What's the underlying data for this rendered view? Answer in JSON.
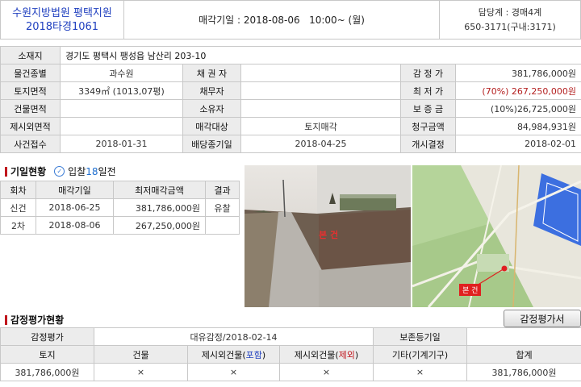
{
  "header": {
    "court": "수원지방법원 평택지원",
    "case_no": "2018타경1061",
    "sale_date": "매각기일 : 2018-08-06   10:00~ (월)",
    "dept": "담당계 : 경매4계",
    "phone": "650-3171(구내:3171)"
  },
  "info": {
    "address_label": "소재지",
    "address": "경기도 평택시 팽성읍 남산리 203-10",
    "rows": [
      [
        "물건종별",
        "과수원",
        "채 권 자",
        "",
        "감 정 가",
        "381,786,000원"
      ],
      [
        "토지면적",
        "3349㎡ (1013,07평)",
        "채무자",
        "",
        "최 저 가",
        "(70%) 267,250,000원"
      ],
      [
        "건물면적",
        "",
        "소유자",
        "",
        "보 증 금",
        "(10%)26,725,000원"
      ],
      [
        "제시외면적",
        "",
        "매각대상",
        "토지매각",
        "청구금액",
        "84,984,931원"
      ],
      [
        "사건접수",
        "2018-01-31",
        "배당종기일",
        "2018-04-25",
        "개시결정",
        "2018-02-01"
      ]
    ]
  },
  "history": {
    "title": "기일현황",
    "badge_prefix": "입찰",
    "badge_days": "18",
    "badge_suffix": "일전",
    "headers": [
      "회차",
      "매각기일",
      "최저매각금액",
      "결과"
    ],
    "rows": [
      [
        "신건",
        "2018-06-25",
        "381,786,000원",
        "유찰"
      ],
      [
        "2차",
        "2018-08-06",
        "267,250,000원",
        ""
      ]
    ]
  },
  "photo_label": "본 건",
  "map_label": "본 건",
  "appraisal": {
    "title": "감정평가현황",
    "button": "감정평가서",
    "row1": [
      "감정평가",
      "대유감정/2018-02-14",
      "보존등기일",
      ""
    ],
    "headers": [
      "토지",
      "건물",
      "제시외건물(포함)",
      "제시외건물(제외)",
      "기타(기계기구)",
      "합계"
    ],
    "values": [
      "381,786,000원",
      "×",
      "×",
      "×",
      "×",
      "381,786,000원"
    ],
    "include_word": "포함",
    "exclude_word": "제외"
  },
  "colors": {
    "accent_blue": "#1f3fbf",
    "accent_red": "#b42020",
    "label_bg": "#ececec"
  }
}
